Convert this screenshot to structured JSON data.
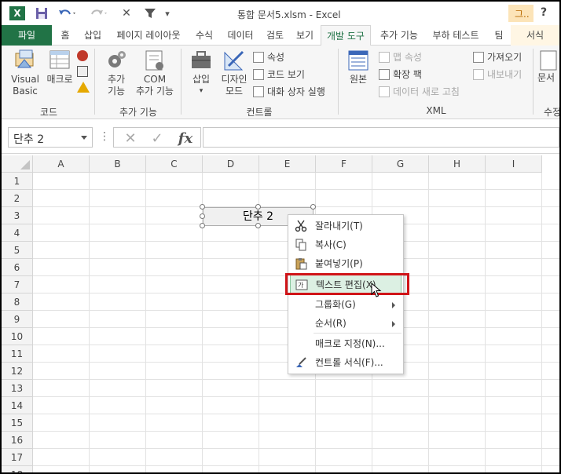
{
  "window": {
    "title": "통합 문서5.xlsm - Excel",
    "context_tab_short": "그..",
    "help": "?"
  },
  "quick_access": {
    "app_icon": "X",
    "save_icon": "save-icon",
    "undo_icon": "undo-icon",
    "redo_icon": "redo-icon",
    "clear_icon": "✕",
    "filter_icon": "filter-icon",
    "customize_icon": "▾"
  },
  "tabs": [
    {
      "label": "파일"
    },
    {
      "label": "홈"
    },
    {
      "label": "삽입"
    },
    {
      "label": "페이지 레이아웃"
    },
    {
      "label": "수식"
    },
    {
      "label": "데이터"
    },
    {
      "label": "검토"
    },
    {
      "label": "보기"
    },
    {
      "label": "개발 도구"
    },
    {
      "label": "추가 기능"
    },
    {
      "label": "부하 테스트"
    },
    {
      "label": "팀"
    },
    {
      "label": "서식"
    }
  ],
  "ribbon": {
    "code": {
      "label": "코드",
      "visual_basic_1": "Visual",
      "visual_basic_2": "Basic",
      "macro": "매크로"
    },
    "addins": {
      "label": "추가 기능",
      "addins_1": "추가",
      "addins_2": "기능",
      "com_1": "COM",
      "com_2": "추가 기능"
    },
    "controls": {
      "label": "컨트롤",
      "insert": "삽입",
      "design_1": "디자인",
      "design_2": "모드",
      "properties": "속성",
      "view_code": "코드 보기",
      "run_dialog": "대화 상자 실행"
    },
    "xml": {
      "label": "XML",
      "source": "원본",
      "map_properties": "맵 속성",
      "expansion_packs": "확장 팩",
      "refresh_data": "데이터 새로 고침",
      "import": "가져오기",
      "export": "내보내기"
    },
    "modify": {
      "label": "수정",
      "document_panel": "문서"
    }
  },
  "formula_bar": {
    "name_box": "단추 2",
    "dots": "⋮",
    "cancel": "✕",
    "enter": "✓",
    "fx": "fx",
    "formula": ""
  },
  "grid": {
    "columns": [
      "A",
      "B",
      "C",
      "D",
      "E",
      "F",
      "G",
      "H",
      "I"
    ],
    "rows": [
      "1",
      "2",
      "3",
      "4",
      "5",
      "6",
      "7",
      "8",
      "9",
      "10",
      "11",
      "12",
      "13",
      "14",
      "15",
      "16",
      "17",
      "18"
    ]
  },
  "control_button": {
    "label": "단추 2"
  },
  "context_menu": {
    "items": [
      {
        "label": "잘라내기(T)",
        "icon": "scissors-icon"
      },
      {
        "label": "복사(C)",
        "icon": "copy-icon"
      },
      {
        "label": "붙여넣기(P)",
        "icon": "paste-icon"
      },
      {
        "label": "텍스트 편집(X)",
        "icon": "edit-text-icon",
        "highlighted": true
      },
      {
        "label": "그룹화(G)",
        "submenu": true
      },
      {
        "label": "순서(R)",
        "submenu": true
      },
      {
        "label": "매크로 지정(N)..."
      },
      {
        "label": "컨트롤 서식(F)...",
        "icon": "format-control-icon"
      }
    ]
  },
  "colors": {
    "excel_green": "#217346",
    "highlight": "#dcf0e3",
    "annotation_red": "#d01418",
    "context_tab": "#fce4b8"
  }
}
